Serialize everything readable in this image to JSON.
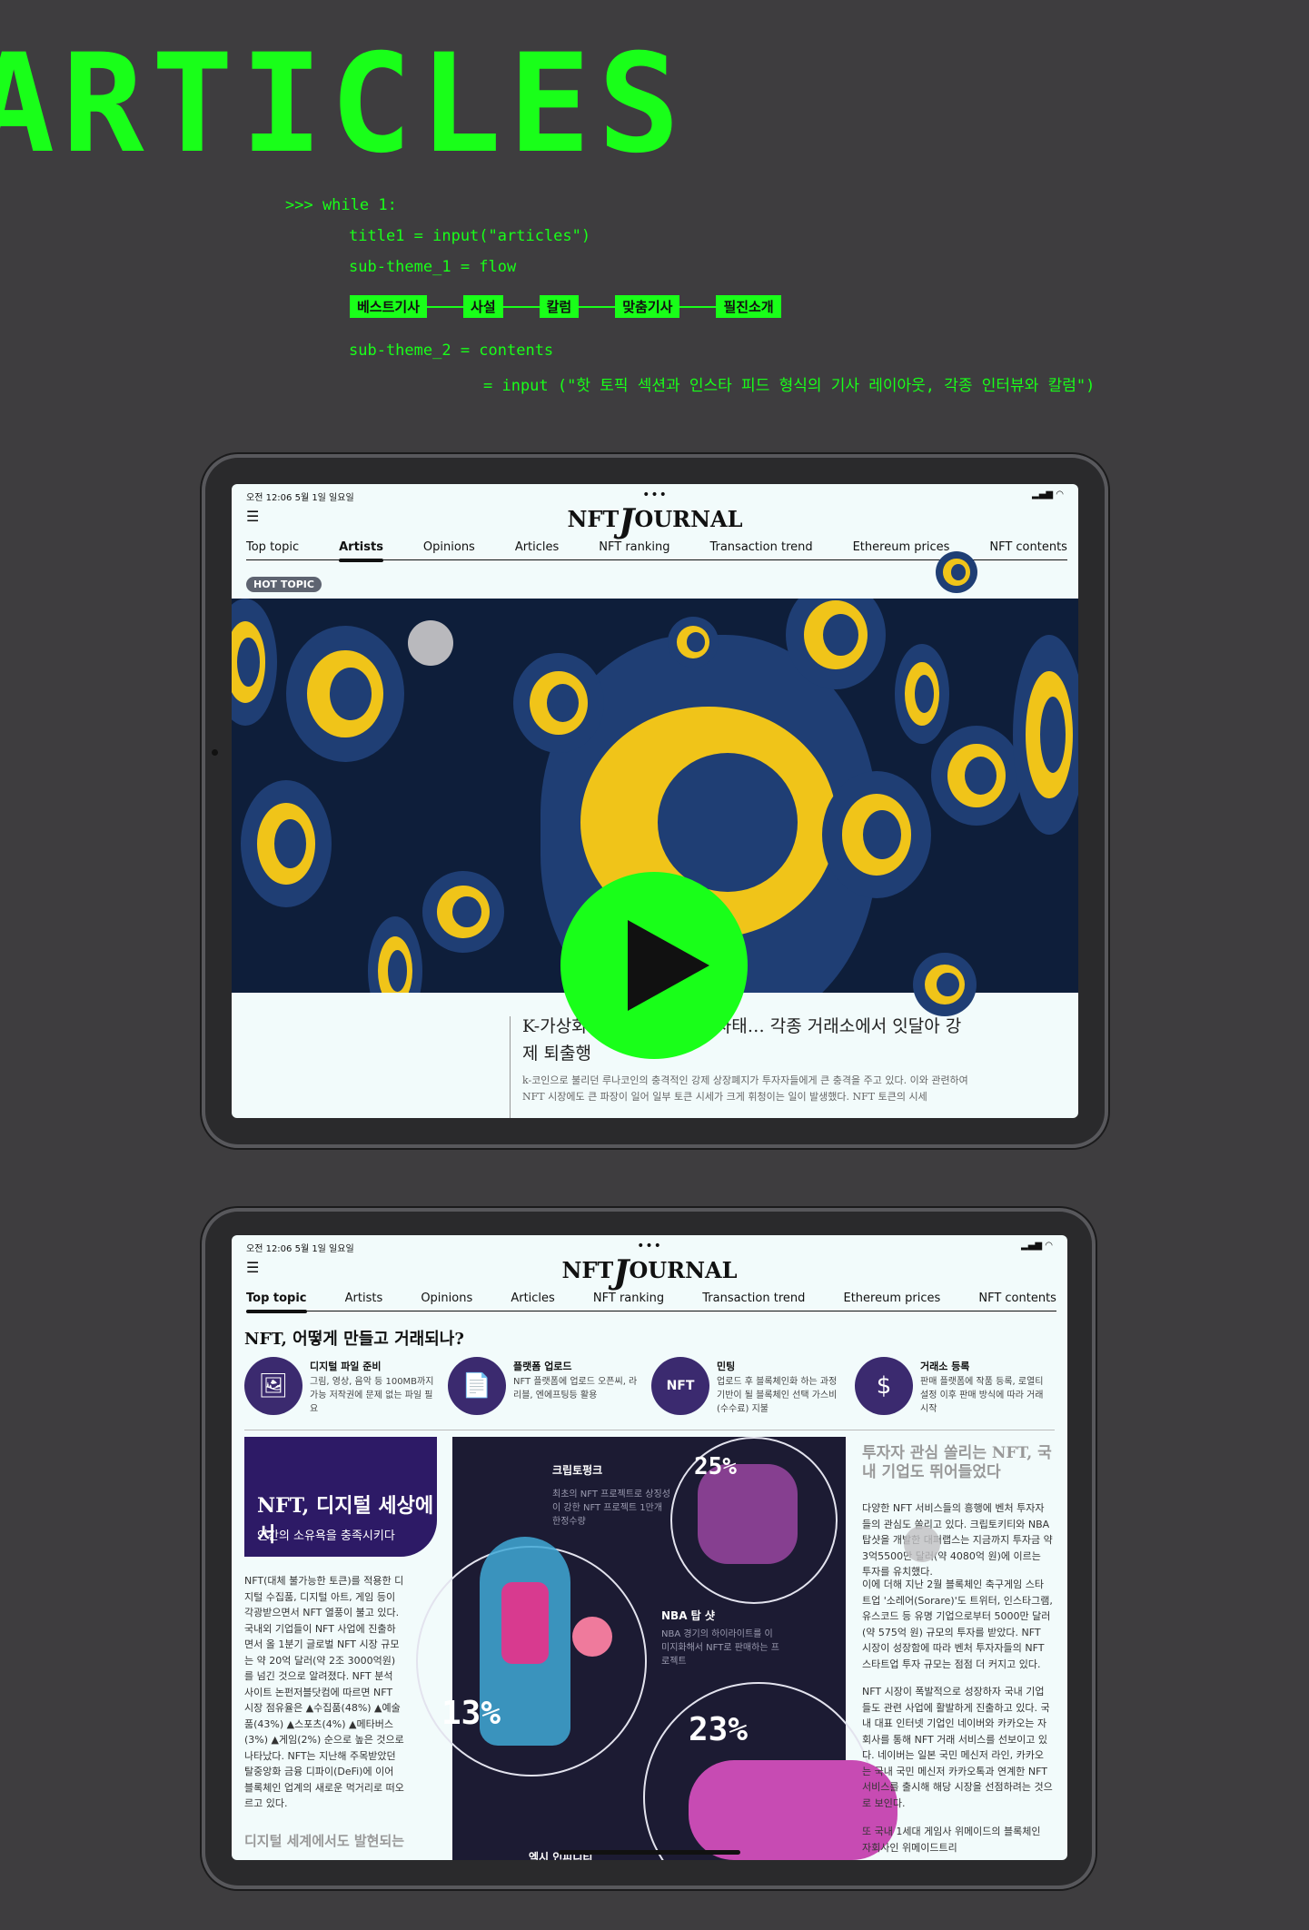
{
  "hero_title": "ARTICLES",
  "code": {
    "line1": ">>> while 1:",
    "line2": "title1 = input(\"articles\")",
    "line3": "sub-theme_1 = flow",
    "flow_steps": [
      "베스트기사",
      "사설",
      "칼럼",
      "맞춤기사",
      "필진소개"
    ],
    "line4": "sub-theme_2 = contents",
    "line5": "= input (\"핫 토픽 섹션과 인스타 피드 형식의 기사 레이아웃, 각종 인터뷰와 칼럼\")"
  },
  "tablet1": {
    "status_time": "오전 12:06  5월 1일 일요일",
    "status_icons": "▂▄▆ ◠",
    "logo_a": "NFT",
    "logo_j": "J",
    "logo_b": "OURNAL",
    "nav": [
      "Top topic",
      "Artists",
      "Opinions",
      "Articles",
      "NFT ranking",
      "Transaction trend",
      "Ethereum prices",
      "NFT contents"
    ],
    "active_nav": "Artists",
    "hot_badge": "HOT TOPIC",
    "headline": "K-가상화폐 ... 대규모 폭락사태… 각종 거래소에서 잇달아 강제 퇴출행",
    "lead": "k-코인으로 불리던 루나코인의 충격적인 강제 상장폐지가 투자자들에게 큰 충격을 주고 있다. 이와 관련하여 NFT 시장에도 큰 파장이 일어 일부 토큰 시세가 크게 휘청이는 일이 발생했다. NFT 토큰의 시세"
  },
  "tablet2": {
    "status_time": "오전 12:06  5월 1일 일요일",
    "status_icons": "▂▄▆ ◠",
    "logo_a": "NFT",
    "logo_j": "J",
    "logo_b": "OURNAL",
    "nav": [
      "Top topic",
      "Artists",
      "Opinions",
      "Articles",
      "NFT ranking",
      "Transaction trend",
      "Ethereum prices",
      "NFT contents"
    ],
    "active_nav": "Top topic",
    "section_title": "NFT, 어떻게 만들고 거래되나?",
    "steps": [
      {
        "icon": "🖼",
        "title": "디지털 파일 준비",
        "desc": "그림, 영상, 음악 등 100MB까지 가능 저작권에 문제 없는 파일 필요"
      },
      {
        "icon": "📄",
        "title": "플랫폼 업로드",
        "desc": "NFT 플랫폼에 업로드 오픈씨, 라리블, 엔에프팅등 활용"
      },
      {
        "icon": "NFT",
        "title": "민팅",
        "desc": "업로드 후 블록체인화 하는 과정 기반이 될 블록체인 선택 가스비 (수수료) 지불"
      },
      {
        "icon": "$",
        "title": "거래소 등록",
        "desc": "판매 플랫폼에 작품 등록, 로열티 설정 이후 판매 방식에 따라 거래 시작"
      }
    ],
    "purple_a": "NFT, 디지털 세상에서",
    "purple_b": "인간의 소유욕을 충족시키다",
    "left_body": "NFT(대체 불가능한 토큰)를 적용한 디지털 수집품, 디지털 아트, 게임 등이 각광받으면서 NFT 열풍이 불고 있다. 국내외 기업들이 NFT 사업에 진출하면서 올 1분기 글로벌 NFT 시장 규모는 약 20억 달러(약 2조 3000억원)를 넘긴 것으로 알려졌다. NFT 분석 사이트 논펀저블닷컴에 따르면 NFT 시장 점유율은 ▲수집품(48%) ▲예술품(43%) ▲스포츠(4%) ▲메타버스(3%) ▲게임(2%) 순으로 높은 것으로 나타났다. NFT는 지난해 주목받았던 탈중앙화 금융 디파이(DeFi)에 이어 블록체인 업계의 새로운 먹거리로 떠오르고 있다.",
    "left_bottom_title": "디지털 세계에서도 발현되는",
    "infographic": {
      "labels": [
        {
          "name": "크립토펑크",
          "desc": "최초의 NFT 프로젝트로 상징성이 강한 NFT 프로젝트 1만개 한정수량",
          "pct": "25%"
        },
        {
          "name": "NBA 탑 샷",
          "desc": "NBA 경기의 하이라이트를 이미지화해서 NFT로 판매하는 프로젝트",
          "pct": "13%"
        },
        {
          "name": "엑시 인피니티",
          "desc": "",
          "pct": "23%"
        }
      ]
    },
    "side_title": "투자자 관심 쏠리는 NFT, 국내 기업도 뛰어들었다",
    "side_p1": "다양한 NFT 서비스들의 흥행에 벤처 투자자들의 관심도 쏠리고 있다. 크립토키티와 NBA탑샷을 개발한 대퍼랩스는 지금까지 투자금 약 3억5500만 달러(약 4080억 원)에 이르는 투자를 유치했다.",
    "side_p2": "이에 더해 지난 2월 블록체인 축구게임 스타트업 '소레어(Sorare)'도 트위터, 인스타그램, 유스코드 등 유명 기업으로부터 5000만 달러(약 575억 원) 규모의 투자를 받았다. NFT 시장이 성장함에 따라 벤처 투자자들의 NFT 스타트업 투자 규모는 점점 더 커지고 있다.",
    "side_p3": "NFT 시장이 폭발적으로 성장하자 국내 기업들도 관련 사업에 활발하게 진출하고 있다. 국내 대표 인터넷 기업인 네이버와 카카오는 자회사를 통해 NFT 거래 서비스를 선보이고 있다. 네이버는 일본 국민 메신저 라인, 카카오는 국내 국민 메신저 카카오톡과 연계한 NFT 서비스를 출시해 해당 시장을 선점하려는 것으로 보인다.",
    "side_p4": "또 국내 1세대 게임사 위메이드의 블록체인 자회사인 위메이드트리"
  },
  "colors": {
    "accent": "#19ff19",
    "background": "#3e3d3f",
    "navy": "#0e1e3a",
    "coin_yellow": "#f0c419",
    "purple": "#2d1a66"
  }
}
